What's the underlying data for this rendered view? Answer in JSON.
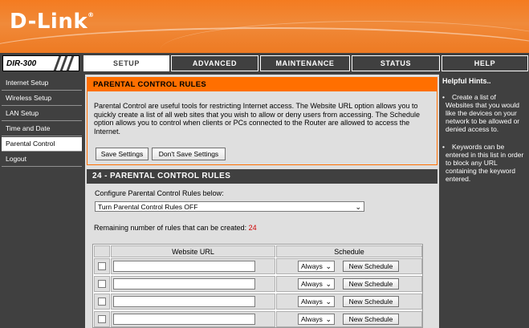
{
  "brand": {
    "logo_text": "D-Link",
    "logo_mark": "®"
  },
  "model": {
    "label": "DIR-300"
  },
  "tabs": [
    {
      "label": "SETUP",
      "active": true
    },
    {
      "label": "ADVANCED",
      "active": false
    },
    {
      "label": "MAINTENANCE",
      "active": false
    },
    {
      "label": "STATUS",
      "active": false
    },
    {
      "label": "HELP",
      "active": false
    }
  ],
  "sidebar": {
    "items": [
      {
        "label": "Internet Setup",
        "active": false
      },
      {
        "label": "Wireless Setup",
        "active": false
      },
      {
        "label": "LAN Setup",
        "active": false
      },
      {
        "label": "Time and Date",
        "active": false
      },
      {
        "label": "Parental Control",
        "active": true
      },
      {
        "label": "Logout",
        "active": false
      }
    ]
  },
  "intro": {
    "title": "PARENTAL CONTROL RULES",
    "description": "Parental Control are useful tools for restricting Internet access. The Website URL option allows you to quickly create a list of all web sites that you wish to allow or deny users from accessing. The Schedule option allows you to control when clients or PCs connected to the Router are allowed to access the Internet.",
    "save_label": "Save Settings",
    "dont_save_label": "Don't Save Settings"
  },
  "rules": {
    "title": "24 - PARENTAL CONTROL RULES",
    "configure_label": "Configure Parental Control Rules below:",
    "mode_selected": "Turn Parental Control Rules OFF",
    "remaining_label": "Remaining number of rules that can be created:",
    "remaining_count": "24",
    "columns": {
      "url": "Website URL",
      "schedule": "Schedule"
    },
    "rows": [
      {
        "checked": false,
        "url": "",
        "schedule": "Always",
        "new_schedule_label": "New Schedule"
      },
      {
        "checked": false,
        "url": "",
        "schedule": "Always",
        "new_schedule_label": "New Schedule"
      },
      {
        "checked": false,
        "url": "",
        "schedule": "Always",
        "new_schedule_label": "New Schedule"
      },
      {
        "checked": false,
        "url": "",
        "schedule": "Always",
        "new_schedule_label": "New Schedule"
      }
    ]
  },
  "hints": {
    "title": "Helpful Hints..",
    "items": [
      "Create a list of Websites that you would like the devices on your network to be allowed or denied access to.",
      "Keywords can be entered in this list in order to block any URL containing the keyword entered."
    ]
  },
  "colors": {
    "accent": "#ff6f00",
    "dark": "#404040",
    "panel": "#dfdfdf",
    "highlight": "#d00000"
  }
}
